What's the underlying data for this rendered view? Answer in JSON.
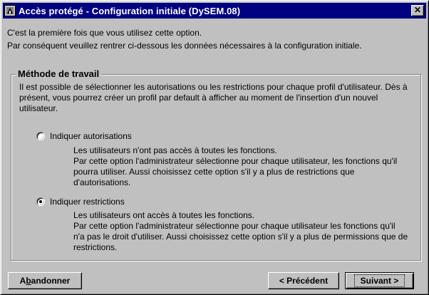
{
  "window": {
    "title": "Accès protégé - Configuration initiale (DySEM.08)",
    "app_icon": "app-icon",
    "close_label": "✕"
  },
  "intro": {
    "line1": "C'est la première fois que vous utilisez cette option.",
    "line2": "Par conséquent veuillez rentrer ci-dessous les données nécessaires à la configuration initiale."
  },
  "group": {
    "title": "Méthode de travail",
    "description": "Il est possible de sélectionner les autorisations ou les restrictions pour chaque profil d'utilisateur. Dès à présent, vous pourrez créer un profil par default à afficher au moment de l'insertion d'un nouvel utilisateur.",
    "options": [
      {
        "label": "Indiquer autorisations",
        "checked": false,
        "description_line1": "Les utilisateurs n'ont pas accès à toutes les fonctions.",
        "description_rest": "Par cette option l'administrateur sélectionne pour chaque utilisateur, les fonctions qu'il pourra utiliser. Aussi choisissez cette option s'il y a plus de restrictions que d'autorisations."
      },
      {
        "label": "Indiquer restrictions",
        "checked": true,
        "description_line1": "Les utilisateurs ont accès à toutes les fonctions.",
        "description_rest": "Par cette option l'administrateur sélectionne pour chaque utilisateur les fonctions qu'il n'a pas le droit d'utiliser. Aussi choisissez cette option s'il y a plus de permissions que de restrictions."
      }
    ]
  },
  "buttons": {
    "cancel": {
      "prefix": "A",
      "mnemonic": "b",
      "suffix": "andonner"
    },
    "previous": "< Précédent",
    "next": "Suivant >"
  }
}
